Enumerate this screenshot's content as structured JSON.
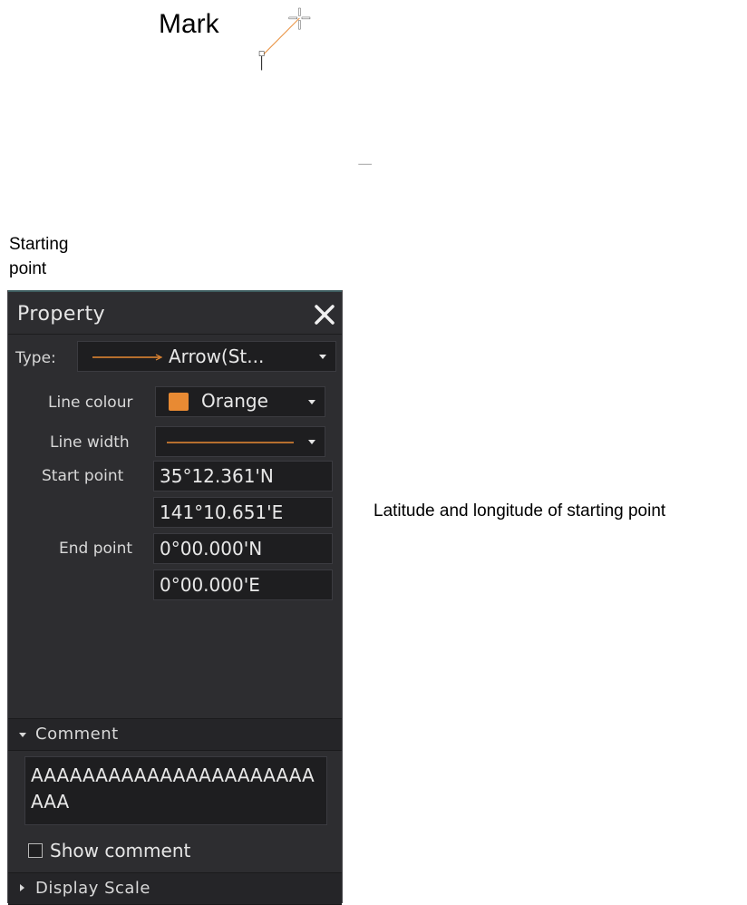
{
  "annotations": {
    "mark": "Mark",
    "starting_point_line1": "Starting",
    "starting_point_line2": "point",
    "latlon_callout": "Latitude and longitude of starting point",
    "line_color": "#e88a33"
  },
  "panel": {
    "title": "Property",
    "close_icon": "close-icon",
    "type": {
      "label": "Type:",
      "value": "Arrow(St...",
      "sample_color": "#e88a33"
    },
    "line_colour": {
      "label": "Line colour",
      "value": "Orange",
      "swatch_color": "#e88a33"
    },
    "line_width": {
      "label": "Line width",
      "sample_color": "#e88a33"
    },
    "start_point": {
      "label": "Start point",
      "lat": "35°12.361'N",
      "lon": "141°10.651'E"
    },
    "end_point": {
      "label": "End point",
      "lat": "0°00.000'N",
      "lon": "0°00.000'E"
    },
    "comment": {
      "section_label": "Comment",
      "text": "AAAAAAAAAAAAAAAAAAAAAAAAA"
    },
    "show_comment": {
      "label": "Show comment",
      "checked": false
    },
    "display_scale": {
      "section_label": "Display Scale"
    }
  },
  "colors": {
    "panel_bg": "#2d2d30",
    "field_bg": "#1e1e20",
    "accent_orange": "#e88a33"
  }
}
